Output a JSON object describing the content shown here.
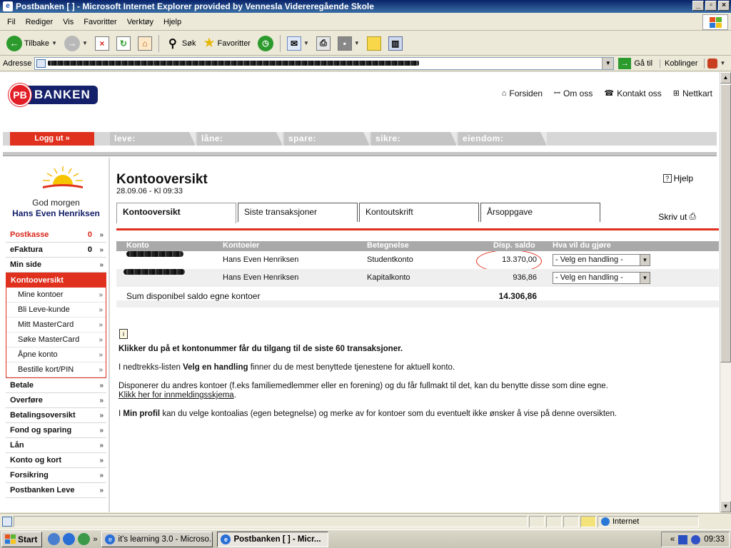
{
  "window": {
    "title": "Postbanken [ ] - Microsoft Internet Explorer provided by Vennesla Videreregående Skole"
  },
  "menubar": [
    "Fil",
    "Rediger",
    "Vis",
    "Favoritter",
    "Verktøy",
    "Hjelp"
  ],
  "toolbar": {
    "back": "Tilbake",
    "search": "Søk",
    "favorites": "Favoritter"
  },
  "addressbar": {
    "label": "Adresse",
    "goto": "Gå til",
    "links": "Koblinger"
  },
  "site": {
    "logo_mark": "PB",
    "logo_word": "BANKEN",
    "topnav": [
      "Forsiden",
      "Om oss",
      "Kontakt oss",
      "Nettkart"
    ],
    "logout": "Logg ut »",
    "maintabs": [
      "leve:",
      "låne:",
      "spare:",
      "sikre:",
      "eiendom:"
    ]
  },
  "sidebar": {
    "greeting": "God morgen",
    "username": "Hans Even Henriksen",
    "items_top": [
      {
        "label": "Postkasse",
        "count": "0"
      },
      {
        "label": "eFaktura",
        "count": "0"
      },
      {
        "label": "Min side"
      }
    ],
    "active": "Kontooversikt",
    "subitems": [
      "Mine kontoer",
      "Bli Leve-kunde",
      "Mitt MasterCard",
      "Søke MasterCard",
      "Åpne konto",
      "Bestille kort/PIN"
    ],
    "items_bottom": [
      "Betale",
      "Overføre",
      "Betalingsoversikt",
      "Fond og sparing",
      "Lån",
      "Konto og kort",
      "Forsikring",
      "Postbanken Leve"
    ],
    "chev": "»"
  },
  "main": {
    "title": "Kontooversikt",
    "date": "28.09.06 - Kl 09:33",
    "help": "Hjelp",
    "help_icon": "?",
    "tabs": [
      "Kontooversikt",
      "Siste transaksjoner",
      "Kontoutskrift",
      "Årsoppgave"
    ],
    "print": "Skriv ut",
    "table": {
      "headers": [
        "Konto",
        "Kontoeier",
        "Betegnelse",
        "Disp. saldo",
        "Hva vil du gjøre"
      ],
      "rows": [
        {
          "owner": "Hans Even Henriksen",
          "type": "Studentkonto",
          "balance": "13.370,00",
          "action": "- Velg en handling -"
        },
        {
          "owner": "Hans Even Henriksen",
          "type": "Kapitalkonto",
          "balance": "936,86",
          "action": "- Velg en handling -"
        }
      ],
      "sum_label": "Sum disponibel saldo egne kontoer",
      "sum_value": "14.306,86"
    },
    "info_icon": "i",
    "info": {
      "p1": "Klikker du på et kontonummer får du tilgang til de siste 60 transaksjoner.",
      "p2_pre": "I nedtrekks-listen ",
      "p2_bold": "Velg en handling",
      "p2_post": " finner du de mest benyttede tjenestene for aktuell konto.",
      "p3": "Disponerer du andres kontoer (f.eks familiemedlemmer eller en forening) og du får fullmakt til det, kan du benytte disse som dine egne.",
      "p3_link": "Klikk her for innmeldingsskjema",
      "p3_end": ".",
      "p4_pre": "I ",
      "p4_bold": "Min profil",
      "p4_post": " kan du velge kontoalias (egen betegnelse) og merke av for kontoer som du eventuelt ikke ønsker å vise på denne oversikten."
    }
  },
  "statusbar": {
    "zone": "Internet"
  },
  "taskbar": {
    "start": "Start",
    "more": "»",
    "tasks": [
      "it's learning 3.0 - Microso...",
      "Postbanken [ ] - Micr..."
    ],
    "tray_more": "«",
    "clock": "09:33"
  },
  "colors": {
    "accent_red": "#e0301e",
    "brand_navy": "#14206a"
  }
}
